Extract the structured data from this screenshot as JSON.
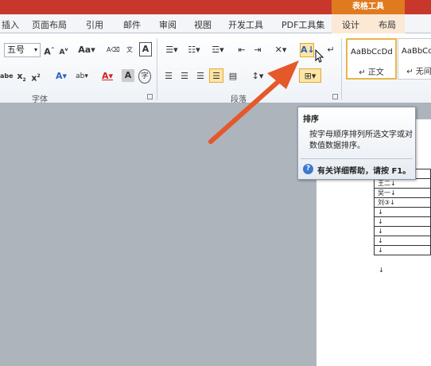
{
  "colors": {
    "accent": "#e5582a",
    "context_tab": "#e07a1e",
    "header": "#c8372c"
  },
  "context_group": "表格工具",
  "tabs": [
    "插入",
    "页面布局",
    "引用",
    "邮件",
    "审阅",
    "视图",
    "开发工具",
    "PDF工具集",
    "设计",
    "布局"
  ],
  "font": {
    "size": "五号",
    "size_arrow": "▾"
  },
  "groups": {
    "font": "字体",
    "paragraph": "段落"
  },
  "styles": [
    {
      "sample": "AaBbCcDd",
      "name": "↵ 正文"
    },
    {
      "sample": "AaBbCcI",
      "name": "↵ 无间隔"
    }
  ],
  "tooltip": {
    "title": "排序",
    "description": "按字母顺序排列所选文字或对数值数据排序。",
    "help_icon": "?",
    "help_text": "有关详细帮助，请按 F1。"
  },
  "table": {
    "rows": [
      "李四↓",
      "王二↓",
      "吴一↓",
      "刘③↓",
      "↓",
      "↓",
      "↓",
      "↓",
      "↓"
    ]
  },
  "para_mark": "↓"
}
